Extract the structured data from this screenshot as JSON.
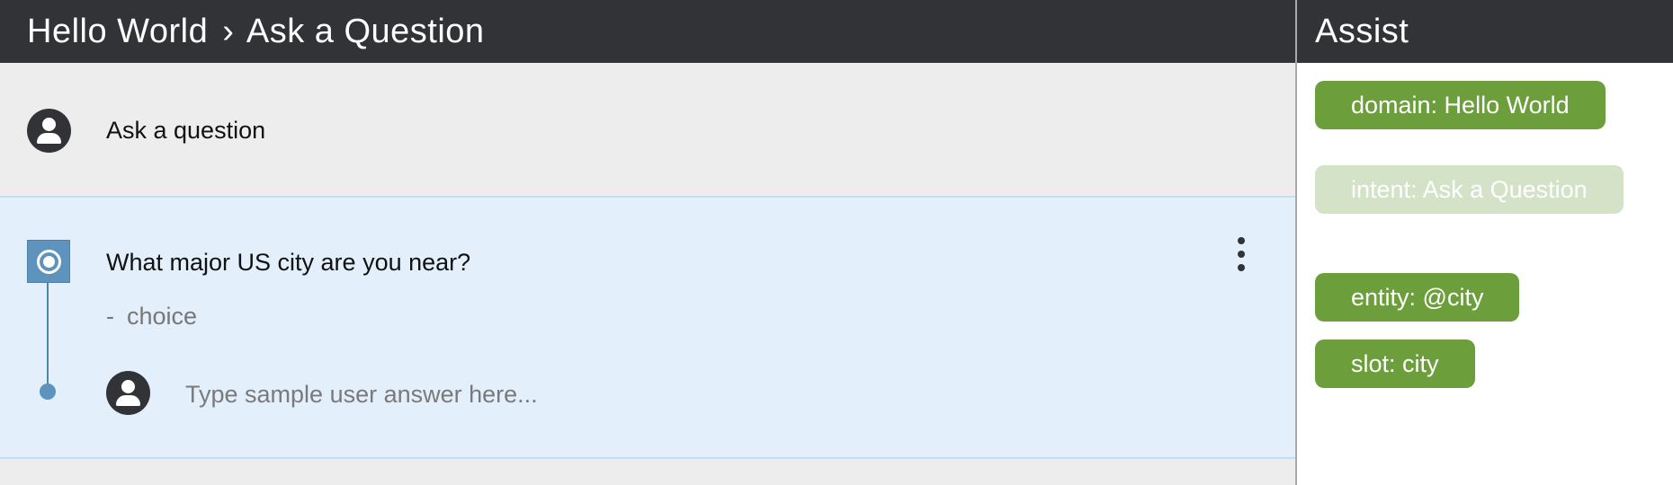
{
  "header": {
    "breadcrumb": [
      "Hello World",
      "Ask a Question"
    ],
    "separator": "›"
  },
  "prompt": {
    "text": "Ask a question"
  },
  "question": {
    "text": "What major US city are you near?",
    "dash": "-",
    "type": "choice",
    "answer_placeholder": "Type sample user answer here...",
    "answer_value": ""
  },
  "assist": {
    "title": "Assist",
    "chips": [
      {
        "label": "domain: Hello World",
        "state": "active"
      },
      {
        "label": "intent: Ask a Question",
        "state": "faded"
      },
      {
        "label": "entity: @city",
        "state": "active"
      },
      {
        "label": "slot: city",
        "state": "active"
      }
    ]
  },
  "colors": {
    "topbar": "#323337",
    "question_bg": "#e3effb",
    "marker": "#5d93bd",
    "chip_active": "#6c9f3b",
    "chip_faded": "#d4e3c8"
  },
  "icons": {
    "user_avatar": "user-icon",
    "question_marker": "radio-target-icon",
    "more_menu": "more-vertical-icon"
  }
}
